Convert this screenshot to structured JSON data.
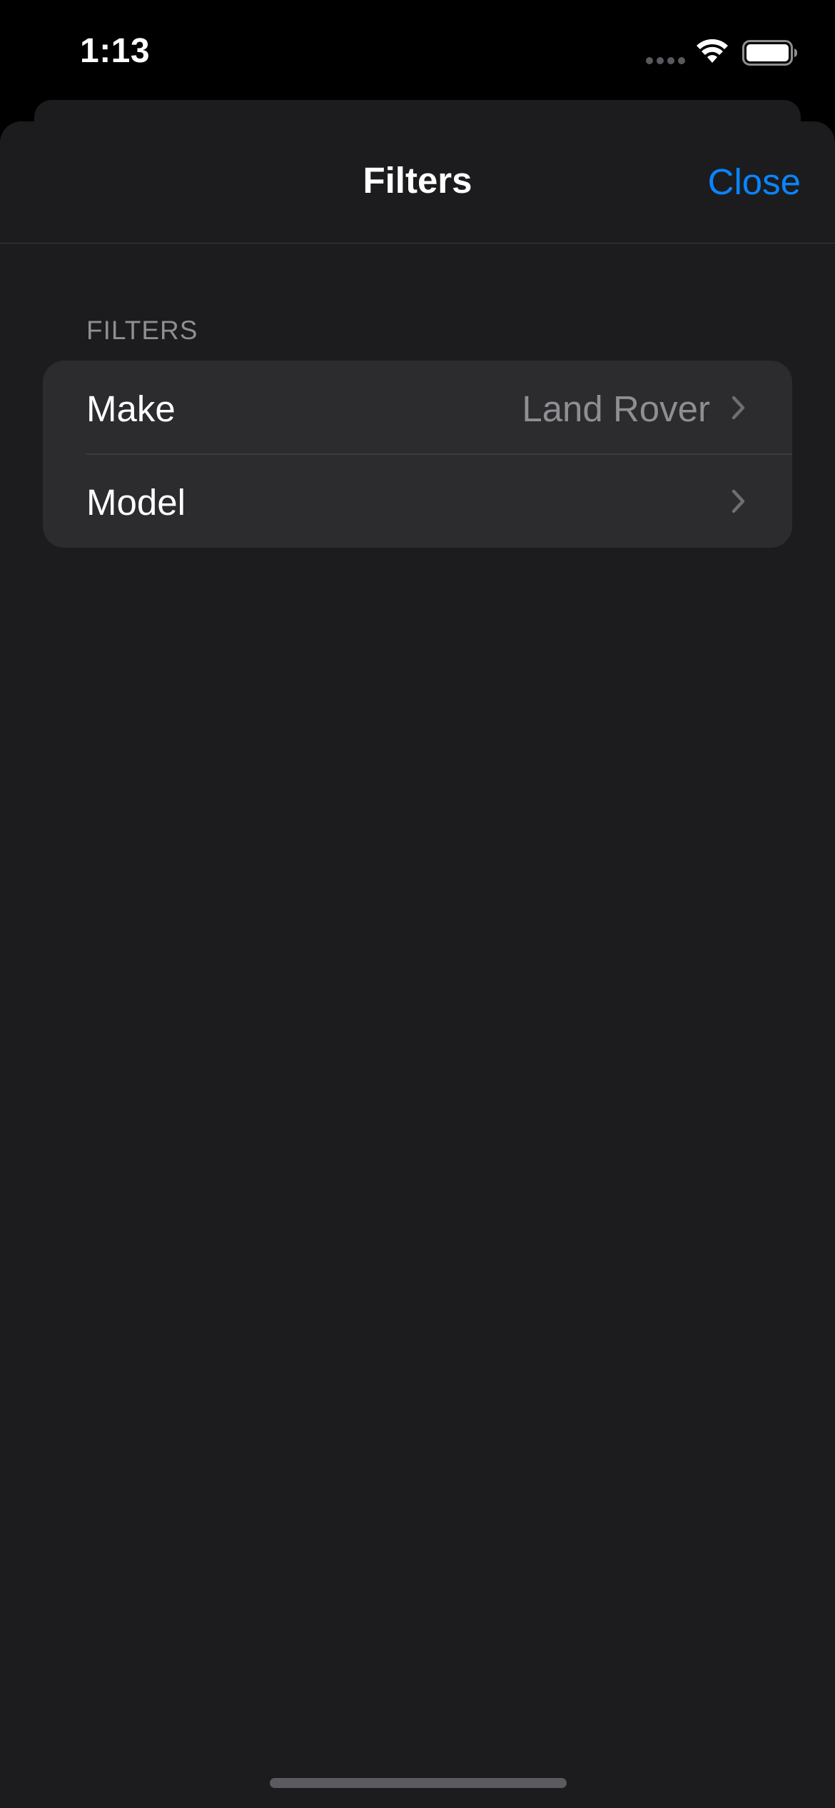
{
  "status_bar": {
    "time": "1:13",
    "signal_icon": "cellular-signal-dots-icon",
    "wifi_icon": "wifi-icon",
    "battery_icon": "battery-full-icon"
  },
  "nav": {
    "title": "Filters",
    "close_label": "Close"
  },
  "section": {
    "header": "FILTERS",
    "rows": [
      {
        "label": "Make",
        "value": "Land Rover",
        "icon": "chevron-right-icon"
      },
      {
        "label": "Model",
        "value": "",
        "icon": "chevron-right-icon"
      }
    ]
  },
  "colors": {
    "accent": "#0a84ff",
    "background": "#1c1c1e",
    "grouped_cell": "#2c2c2e",
    "secondary_text": "#8e8e93"
  }
}
